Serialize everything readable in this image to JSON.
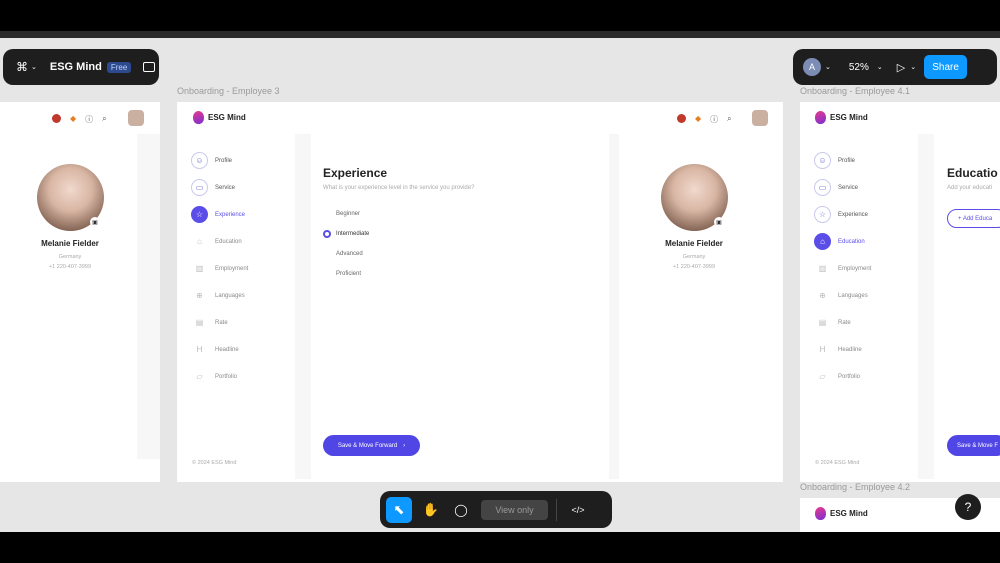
{
  "app": {
    "file_name": "ESG Mind",
    "plan_badge": "Free",
    "avatar_letter": "A",
    "zoom": "52%",
    "share_label": "Share",
    "view_only_label": "View only",
    "help_label": "?",
    "colors": {
      "accent": "#4f46e5",
      "share": "#0d99ff",
      "toolbar": "#1e1e1e"
    }
  },
  "frames": {
    "left": {
      "name": "Melanie Fielder",
      "country": "Germany",
      "phone": "+1 220-407-3999"
    },
    "center": {
      "label": "Onboarding - Employee 3",
      "logo_text": "ESG Mind",
      "nav": [
        "Profile",
        "Service",
        "Experience",
        "Education",
        "Employment",
        "Languages",
        "Rate",
        "Headline",
        "Portfolio"
      ],
      "footer": "© 2024 ESG Mind",
      "heading": "Experience",
      "question": "What is your experience level in the service you provide?",
      "options": [
        "Beginner",
        "Intermediate",
        "Advanced",
        "Proficient"
      ],
      "selected_option": "Intermediate",
      "button_label": "Save & Move Forward",
      "profile": {
        "name": "Melanie Fielder",
        "country": "Germany",
        "phone": "+1 220-407-3999"
      }
    },
    "right": {
      "label": "Onboarding - Employee 4.1",
      "logo_text": "ESG Mind",
      "nav": [
        "Profile",
        "Service",
        "Experience",
        "Education",
        "Employment",
        "Languages",
        "Rate",
        "Headline",
        "Portfolio"
      ],
      "footer": "© 2024 ESG Mind",
      "heading": "Educatio",
      "question": "Add your educati",
      "add_button": "+ Add Educa",
      "button_label": "Save & Move F"
    },
    "bottom": {
      "label": "Onboarding - Employee 4.2",
      "logo_text": "ESG Mind"
    }
  }
}
